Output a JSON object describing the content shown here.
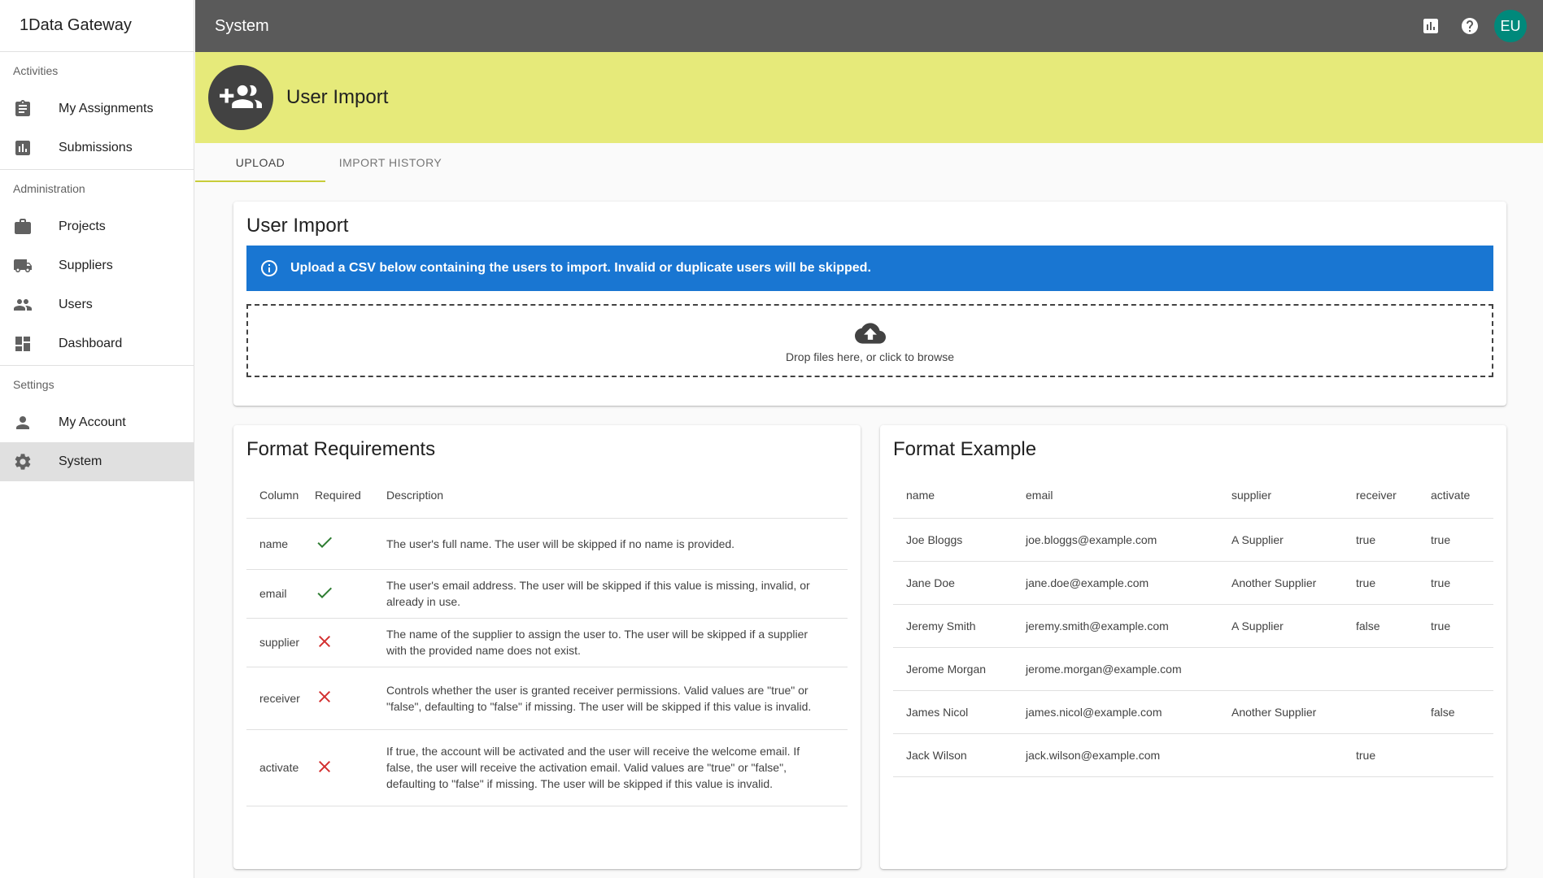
{
  "app": {
    "brand": "1Data Gateway"
  },
  "topbar": {
    "title": "System",
    "avatar_initials": "EU",
    "avatar_color": "#00897b"
  },
  "sidebar": {
    "sections": [
      {
        "label": "Activities",
        "items": [
          {
            "label": "My Assignments",
            "icon": "assignment-icon"
          },
          {
            "label": "Submissions",
            "icon": "bar-chart-icon"
          }
        ]
      },
      {
        "label": "Administration",
        "items": [
          {
            "label": "Projects",
            "icon": "briefcase-icon"
          },
          {
            "label": "Suppliers",
            "icon": "truck-icon"
          },
          {
            "label": "Users",
            "icon": "people-icon"
          },
          {
            "label": "Dashboard",
            "icon": "dashboard-icon"
          }
        ]
      },
      {
        "label": "Settings",
        "items": [
          {
            "label": "My Account",
            "icon": "person-icon"
          },
          {
            "label": "System",
            "icon": "gear-icon",
            "active": true
          }
        ]
      }
    ]
  },
  "banner": {
    "title": "User Import",
    "color": "#e6ea7a"
  },
  "tabs": [
    {
      "label": "UPLOAD",
      "active": true
    },
    {
      "label": "IMPORT HISTORY"
    }
  ],
  "upload": {
    "title": "User Import",
    "info": "Upload a CSV below containing the users to import. Invalid or duplicate users will be skipped.",
    "dropzone": "Drop files here, or click to browse",
    "info_color": "#1976d2"
  },
  "requirements": {
    "title": "Format Requirements",
    "headers": [
      "Column",
      "Required",
      "Description"
    ],
    "rows": [
      {
        "column": "name",
        "required": true,
        "description": "The user's full name. The user will be skipped if no name is provided."
      },
      {
        "column": "email",
        "required": true,
        "description": "The user's email address. The user will be skipped if this value is missing, invalid, or already in use."
      },
      {
        "column": "supplier",
        "required": false,
        "description": "The name of the supplier to assign the user to. The user will be skipped if a supplier with the provided name does not exist."
      },
      {
        "column": "receiver",
        "required": false,
        "description": "Controls whether the user is granted receiver permissions. Valid values are \"true\" or \"false\", defaulting to \"false\" if missing. The user will be skipped if this value is invalid."
      },
      {
        "column": "activate",
        "required": false,
        "description": "If true, the account will be activated and the user will receive the welcome email. If false, the user will receive the activation email. Valid values are \"true\" or \"false\", defaulting to \"false\" if missing. The user will be skipped if this value is invalid."
      }
    ]
  },
  "example": {
    "title": "Format Example",
    "headers": [
      "name",
      "email",
      "supplier",
      "receiver",
      "activate"
    ],
    "rows": [
      [
        "Joe Bloggs",
        "joe.bloggs@example.com",
        "A Supplier",
        "true",
        "true"
      ],
      [
        "Jane Doe",
        "jane.doe@example.com",
        "Another Supplier",
        "true",
        "true"
      ],
      [
        "Jeremy Smith",
        "jeremy.smith@example.com",
        "A Supplier",
        "false",
        "true"
      ],
      [
        "Jerome Morgan",
        "jerome.morgan@example.com",
        "",
        "",
        ""
      ],
      [
        "James Nicol",
        "james.nicol@example.com",
        "Another Supplier",
        "",
        "false"
      ],
      [
        "Jack Wilson",
        "jack.wilson@example.com",
        "",
        "true",
        ""
      ]
    ]
  }
}
